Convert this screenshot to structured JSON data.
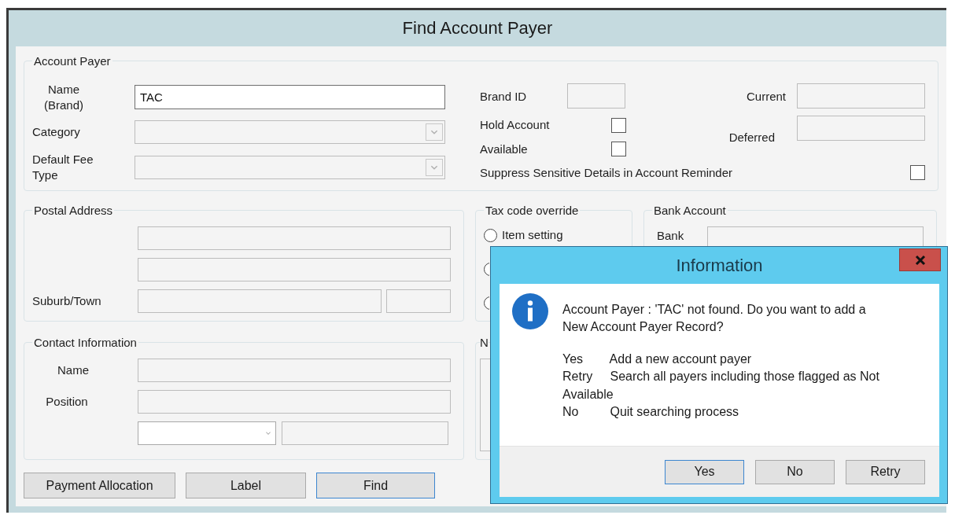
{
  "window": {
    "title": "Find Account Payer"
  },
  "account_payer": {
    "legend": "Account Payer",
    "name": {
      "label": "Name (Brand)",
      "value": "TAC",
      "disabled": false
    },
    "category": {
      "label": "Category",
      "disabled": true
    },
    "default_fee_type": {
      "label": "Default Fee Type",
      "disabled": true
    },
    "brand_id": {
      "label": "Brand ID",
      "disabled": true
    },
    "hold_account": {
      "label": "Hold Account",
      "checked": false
    },
    "available": {
      "label": "Available",
      "checked": false
    },
    "current": {
      "label": "Current",
      "disabled": true
    },
    "deferred": {
      "label": "Deferred",
      "disabled": true
    },
    "suppress": {
      "label": "Suppress Sensitive Details in Account Reminder",
      "checked": false
    }
  },
  "postal_address": {
    "legend": "Postal Address",
    "lines": [
      {
        "disabled": true
      },
      {
        "disabled": true
      }
    ],
    "suburb": {
      "label": "Suburb/Town",
      "disabled": true
    },
    "postcode": {
      "disabled": true
    }
  },
  "tax_code_override": {
    "legend": "Tax code override",
    "options": [
      {
        "kind": "radio",
        "label": "Item setting",
        "selected": false
      },
      {
        "kind": "radio",
        "selected": false
      },
      {
        "kind": "radio",
        "selected": false
      }
    ]
  },
  "bank_account": {
    "legend": "Bank Account",
    "bank": {
      "label": "Bank",
      "disabled": true
    }
  },
  "contact": {
    "legend": "Contact Information",
    "name": {
      "label": "Name",
      "disabled": true
    },
    "position": {
      "label": "Position",
      "disabled": true
    },
    "phone_type": {
      "disabled": false
    },
    "phone": {
      "disabled": true
    }
  },
  "panel_4": {
    "legend": "N"
  },
  "buttons": [
    {
      "label": "Payment Allocation",
      "default": false
    },
    {
      "label": "Label",
      "default": false
    },
    {
      "label": "Find",
      "default": true
    }
  ],
  "dialog": {
    "title": "Information",
    "message": "Account Payer : 'TAC' not found. Do you want to add a New Account Payer Record?",
    "options": [
      {
        "key": "Yes",
        "text": "Add a new account payer"
      },
      {
        "key": "Retry",
        "text": "Search all payers including those flagged as Not Available"
      },
      {
        "key": "No",
        "text": "Quit searching process"
      }
    ],
    "buttons": [
      {
        "label": "Yes",
        "default": true
      },
      {
        "label": "No",
        "default": false
      },
      {
        "label": "Retry",
        "default": false
      }
    ]
  }
}
